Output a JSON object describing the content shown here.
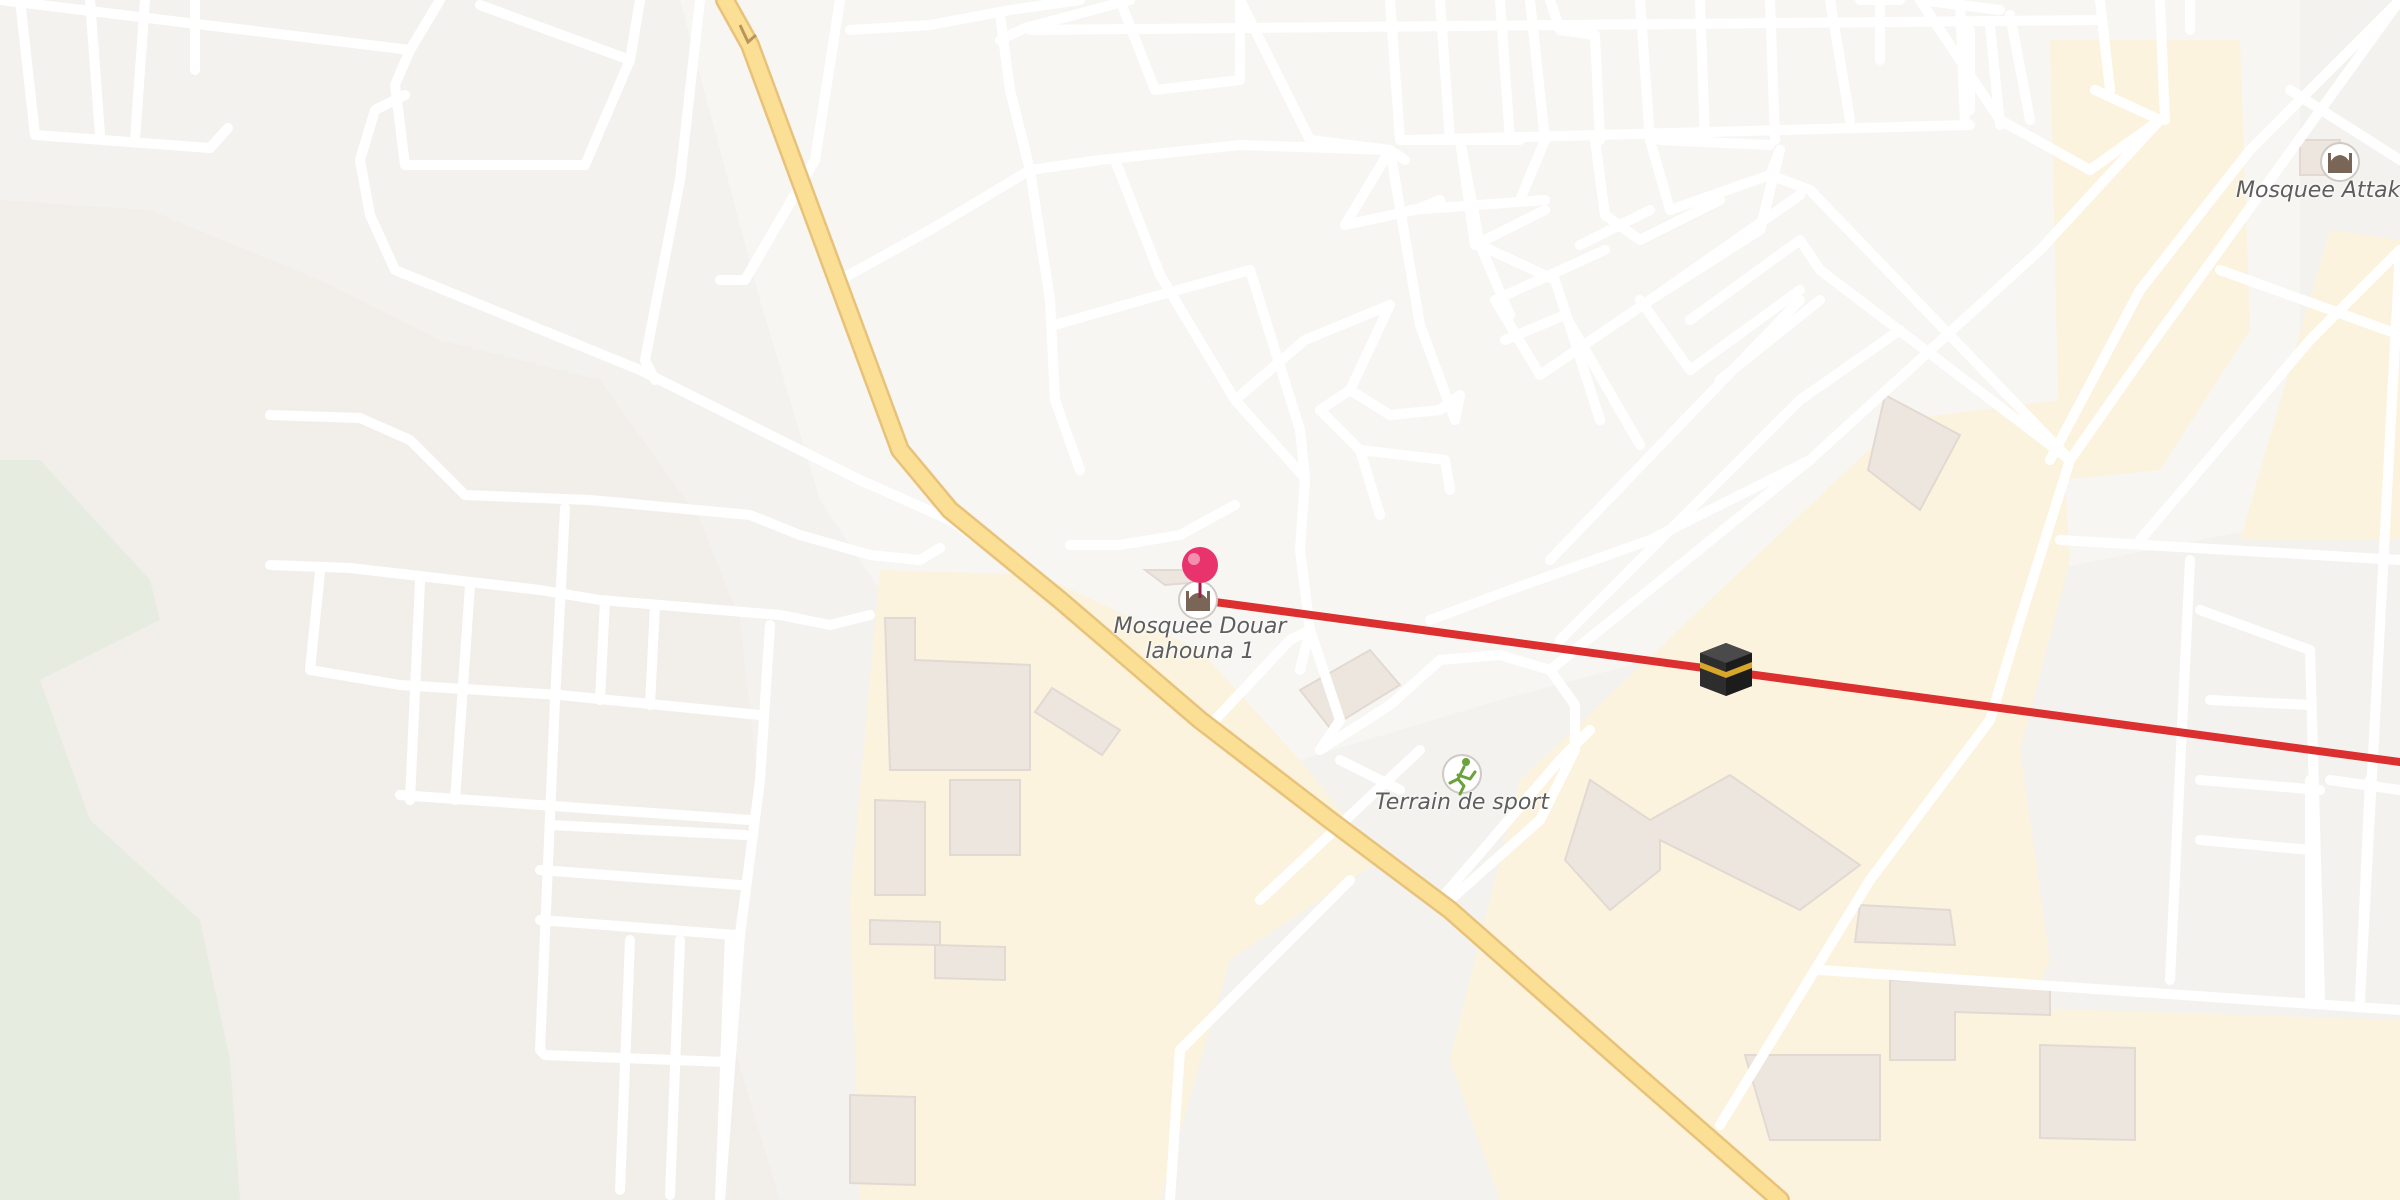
{
  "map": {
    "colors": {
      "land": "#f4f2ef",
      "residential": "#f7f6f3",
      "school_area": "#fbf3dd",
      "park": "#e6ecdf",
      "building": "#ede6df",
      "road_minor": "#ffffff",
      "road_main": "#fbdf94",
      "road_main_casing": "#e9c27a",
      "route_line": "#dc2f2f",
      "pin": "#e8336d"
    },
    "pois": [
      {
        "name": "Mosquee Douar lahouna 1",
        "line1": "Mosquee Douar",
        "line2": "lahouna 1",
        "icon": "mosque-icon"
      },
      {
        "name": "Terrain de sport",
        "line1": "Terrain de sport",
        "icon": "sport-field-icon"
      },
      {
        "name": "Mosquee Attakad",
        "line1": "Mosquee Attakad",
        "icon": "mosque-icon"
      }
    ],
    "pin": {
      "icon": "location-pin-icon",
      "color": "#e8336d"
    },
    "qibla": {
      "icon": "kaaba-icon",
      "line_color": "#dc2f2f"
    }
  }
}
